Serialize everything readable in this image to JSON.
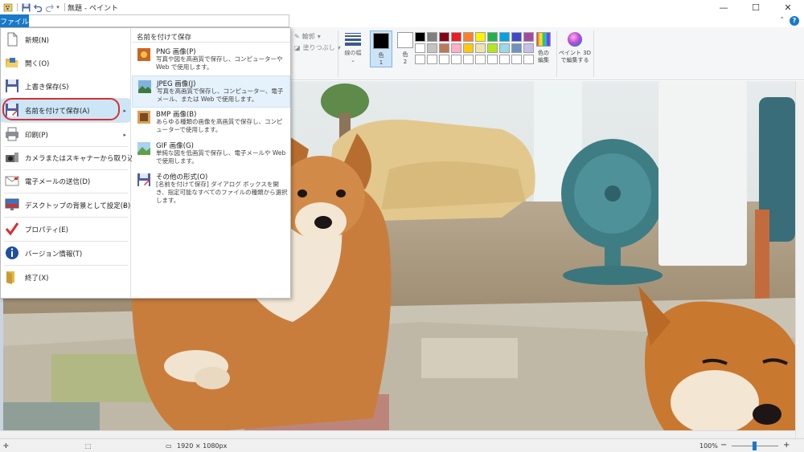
{
  "window": {
    "title": "無題 - ペイント",
    "controls": {
      "minimize": "—",
      "maximize": "☐",
      "close": "✕"
    }
  },
  "quick_access": {
    "menu_glyph": "▾"
  },
  "tabs": {
    "file": "ファイル",
    "help": "?",
    "collapse": "⌃"
  },
  "ribbon": {
    "outline": "輪郭",
    "fill": "塗りつぶし",
    "sizes_label": "線の幅",
    "color1_label": "色\n1",
    "color2_label": "色\n2",
    "palette_label": "色",
    "edit_colors_label": "色の\n編集",
    "paint3d_label": "ペイント 3D\nで編集する",
    "colors": {
      "color1": "#000000",
      "color2": "#ffffff",
      "palette_row1": [
        "#000000",
        "#7f7f7f",
        "#880015",
        "#ed1c24",
        "#ff7f27",
        "#fff200",
        "#22b14c",
        "#00a2e8",
        "#3f48cc",
        "#a349a4"
      ],
      "palette_row2": [
        "#ffffff",
        "#c3c3c3",
        "#b97a57",
        "#ffaec9",
        "#ffc90e",
        "#efe4b0",
        "#b5e61d",
        "#99d9ea",
        "#7092be",
        "#c8bfe7"
      ],
      "palette_row3": [
        "#ffffff",
        "#ffffff",
        "#ffffff",
        "#ffffff",
        "#ffffff",
        "#ffffff",
        "#ffffff",
        "#ffffff",
        "#ffffff",
        "#ffffff"
      ]
    }
  },
  "file_menu": {
    "items": [
      {
        "label": "新規(N)",
        "icon": "new-file-icon"
      },
      {
        "label": "開く(O)",
        "icon": "open-folder-icon"
      },
      {
        "label": "上書き保存(S)",
        "icon": "save-icon"
      },
      {
        "label": "名前を付けて保存(A)",
        "icon": "save-as-icon"
      },
      {
        "label": "印刷(P)",
        "icon": "printer-icon"
      },
      {
        "label": "カメラまたはスキャナーから取り込み(M)",
        "icon": "scanner-icon"
      },
      {
        "label": "電子メールの送信(D)",
        "icon": "email-icon"
      },
      {
        "label": "デスクトップの背景として設定(B)",
        "icon": "desktop-icon"
      },
      {
        "label": "プロパティ(E)",
        "icon": "checkmark-icon"
      },
      {
        "label": "バージョン情報(T)",
        "icon": "info-icon"
      },
      {
        "label": "終了(X)",
        "icon": "exit-icon"
      }
    ],
    "submenu_arrow": "▸",
    "submenu": {
      "title": "名前を付けて保存",
      "items": [
        {
          "title": "PNG 画像(P)",
          "desc": "写真や図を高画質で保存し、コンピューターや Web で使用します。"
        },
        {
          "title": "JPEG 画像(J)",
          "desc": "写真を高画質で保存し、コンピューター、電子メール、または Web で使用します。"
        },
        {
          "title": "BMP 画像(B)",
          "desc": "あらゆる種類の画像を高画質で保存し、コンピューターで使用します。"
        },
        {
          "title": "GIF 画像(G)",
          "desc": "単純な図を低画質で保存し、電子メールや Web で使用します。"
        },
        {
          "title": "その他の形式(O)",
          "desc": "[名前を付けて保存] ダイアログ ボックスを開き、指定可能なすべてのファイルの種類から選択します。"
        }
      ]
    }
  },
  "statusbar": {
    "cursor_icon": "✛",
    "selection_icon": "⬚",
    "dimensions": "1920 × 1080px",
    "zoom": "100%",
    "zoom_out": "−",
    "zoom_in": "+"
  }
}
